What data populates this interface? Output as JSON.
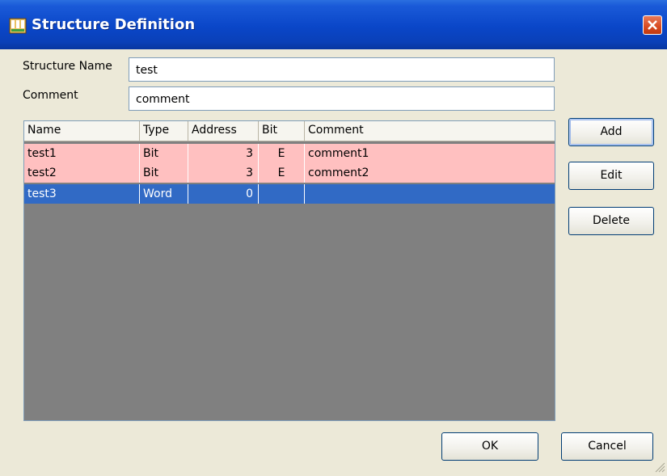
{
  "window": {
    "title": "Structure Definition"
  },
  "form": {
    "structure_name_label": "Structure Name",
    "structure_name_value": "test",
    "comment_label": "Comment",
    "comment_value": "comment"
  },
  "table": {
    "columns": [
      "Name",
      "Type",
      "Address",
      "Bit",
      "Comment"
    ],
    "rows": [
      {
        "name": "test1",
        "type": "Bit",
        "address": "3",
        "bit": "E",
        "comment": "comment1"
      },
      {
        "name": "test2",
        "type": "Bit",
        "address": "3",
        "bit": "E",
        "comment": "comment2"
      },
      {
        "name": "test3",
        "type": "Word",
        "address": "0",
        "bit": "",
        "comment": ""
      }
    ]
  },
  "buttons": {
    "add": "Add",
    "edit": "Edit",
    "delete": "Delete",
    "ok": "OK",
    "cancel": "Cancel"
  },
  "colors": {
    "title_bar": "#0a46c8",
    "row_highlight": "#ffc0c0",
    "row_selected": "#316ac5",
    "table_empty": "#808080",
    "dialog_bg": "#ece9d8"
  },
  "icons": {
    "app": "structure-app-icon",
    "close": "close-icon",
    "resize": "resize-grip-icon"
  }
}
